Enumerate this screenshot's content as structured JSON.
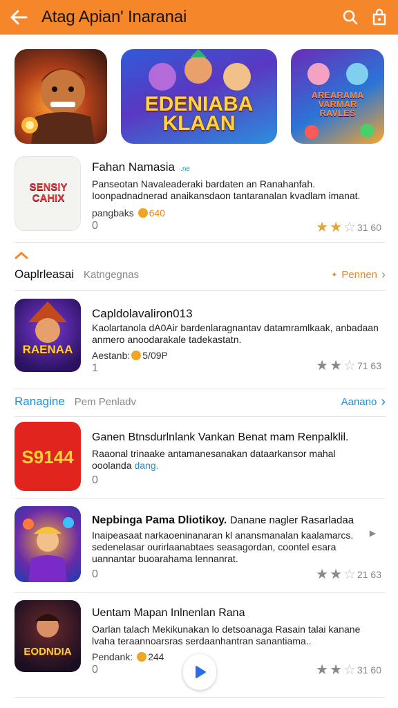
{
  "header": {
    "title": "Atag Apian' Inaranai"
  },
  "banners": [
    {
      "label": ""
    },
    {
      "label": "EDENIABA\nKLAAN"
    },
    {
      "label": "AREARAMA\nVARMAR\nRAVLES"
    }
  ],
  "featured": {
    "icon_text": "SENSIY CAHIX",
    "name": "Fahan Namasia",
    "tag": "·.ne",
    "description": "Panseotan Navaleaderaki bardaten an Ranahanfah. Ioonpadnadnerad anaikansdaon tantaranalan kvadlam imanat.",
    "meta_label": "pangbaks",
    "meta_value": "640",
    "count": "0",
    "rating": "31 60"
  },
  "section1": {
    "title": "Oaplrleasai",
    "subtitle": "Katngegnas",
    "link": "Pennen"
  },
  "apps": [
    {
      "icon_text": "RAENAA",
      "name": "Capldolavaliron013",
      "description": "Kaolartanola dA0Air bardenlaragnantav datamramlkaak, anbadaan anmero anoodarakale tadekastatn.",
      "meta_label": "Aestanb:",
      "meta_value": "5/09P",
      "count": "1",
      "rating": "71 63"
    }
  ],
  "section2": {
    "title": "Ranagine",
    "subtitle": "Pem Penladv",
    "link": "Aanano"
  },
  "apps2": [
    {
      "icon_text": "S9144",
      "name": "Ganen Btnsdurlnlank Vankan Benat mam Renpalklil.",
      "description": "Raaonal trinaake antamanesanakan dataarkansor mahal",
      "description_link_pre": "ooolanda",
      "description_link": "dang.",
      "count": "0"
    },
    {
      "name": "Nepbinga Pama Dliotikoy.",
      "name_extra": "Danane nagler Rasarladaa",
      "description": "Inaipeasaat narkaoeninanaran kl anansmanalan kaalamarcs. sedenelasar ourirlaanabtaes seasagordan, coontel esara uannantar buoarahama lennanrat.",
      "count": "0",
      "rating": "21 63"
    },
    {
      "icon_text": "EODNDIA",
      "name": "Uentam Mapan Inlnenlan Rana",
      "description": "Oarlan talach Mekikunakan lo detsoanaga Rasain talai kanane lvaha teraannoarsras serdaanhantran sanantiama..",
      "meta_label": "Pendank:",
      "meta_value": "244",
      "count": "0",
      "rating": "31 60"
    }
  ],
  "colors": {
    "accent": "#f5862a",
    "link_orange": "#e68a1c",
    "link_blue": "#1a8fd6",
    "star": "#e4a43a"
  }
}
